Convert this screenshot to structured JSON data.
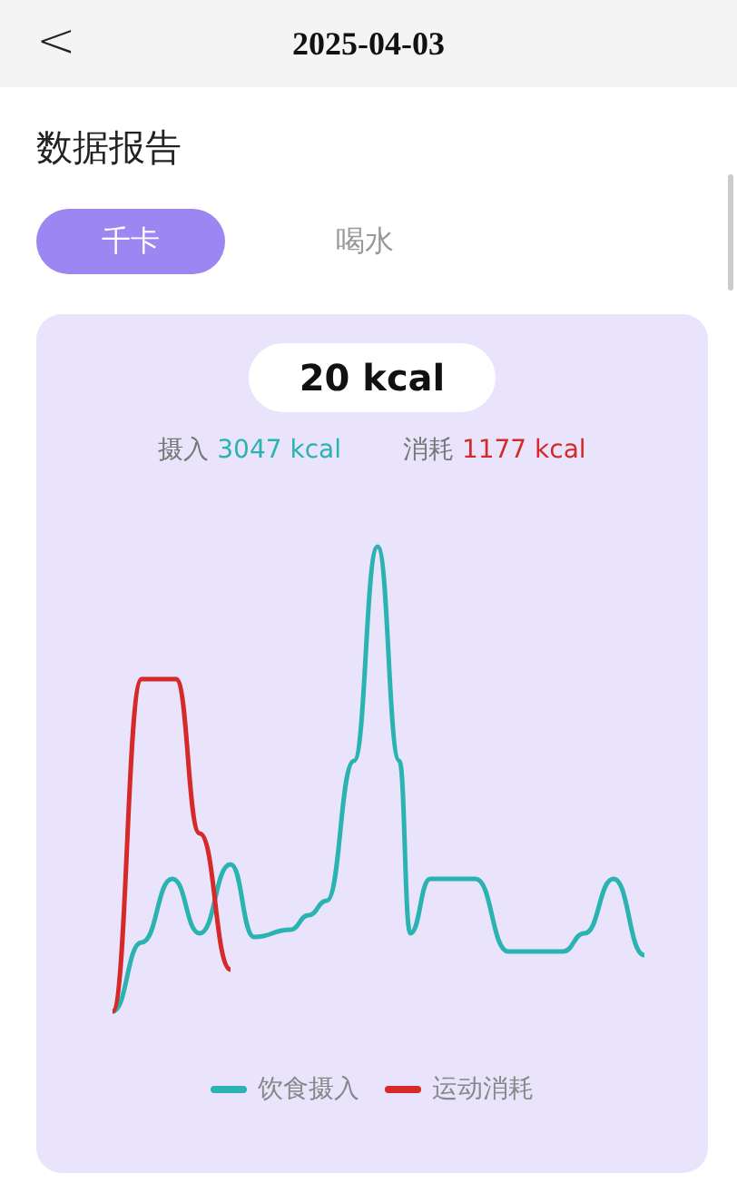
{
  "header": {
    "back_icon": "<",
    "title": "2025-04-03"
  },
  "section_title": "数据报告",
  "tabs": [
    {
      "label": "千卡",
      "selected": true
    },
    {
      "label": "喝水",
      "selected": false
    }
  ],
  "summary": {
    "net": "20 kcal",
    "stats": [
      {
        "label": "摄入",
        "value": "3047 kcal",
        "color": "#2ab3b0"
      },
      {
        "label": "消耗",
        "value": "1177 kcal",
        "color": "#d42a2a"
      }
    ]
  },
  "legend": [
    {
      "name": "饮食摄入",
      "color": "#2ab3b0"
    },
    {
      "name": "运动消耗",
      "color": "#d42a2a"
    }
  ]
}
